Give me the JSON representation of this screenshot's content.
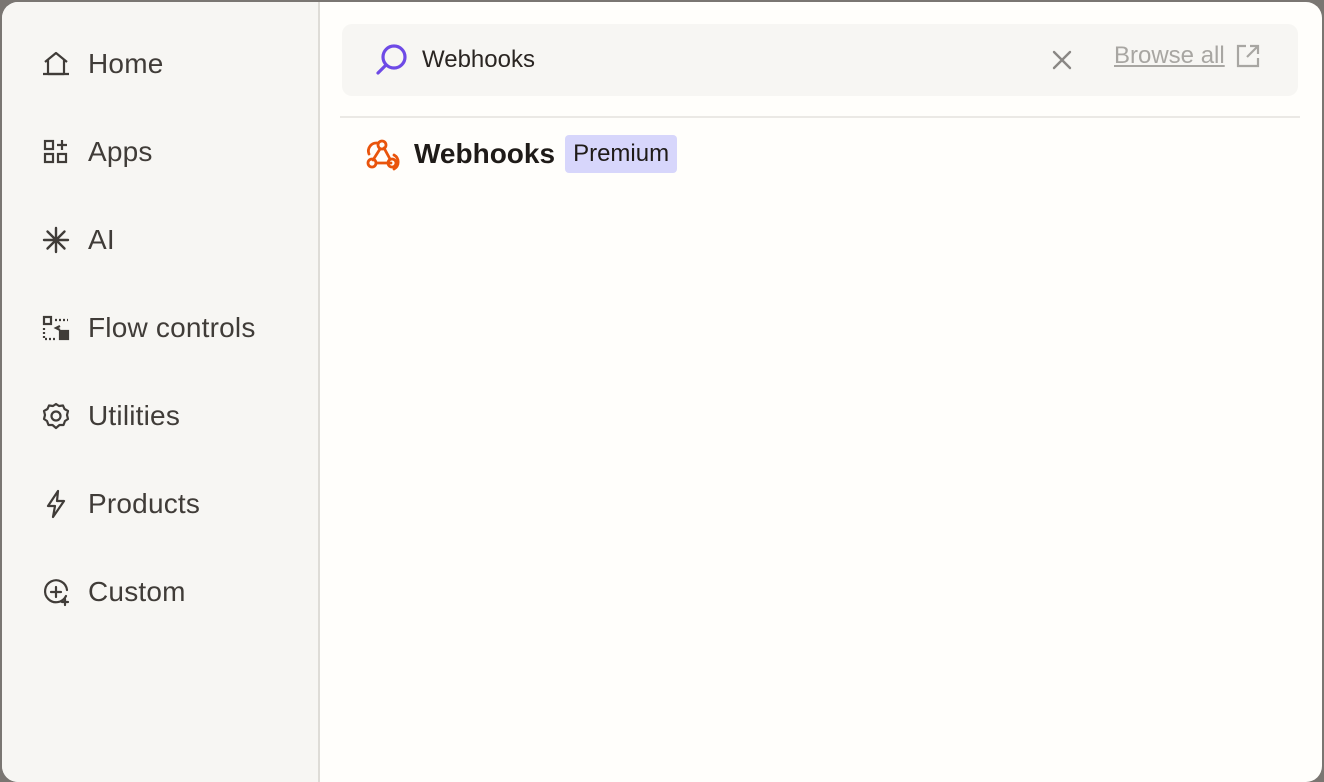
{
  "sidebar": {
    "items": [
      {
        "label": "Home",
        "icon": "home-icon"
      },
      {
        "label": "Apps",
        "icon": "apps-icon"
      },
      {
        "label": "AI",
        "icon": "sparkle-icon"
      },
      {
        "label": "Flow controls",
        "icon": "flow-controls-icon"
      },
      {
        "label": "Utilities",
        "icon": "gear-icon"
      },
      {
        "label": "Products",
        "icon": "lightning-icon"
      },
      {
        "label": "Custom",
        "icon": "custom-plus-icon"
      }
    ]
  },
  "search": {
    "value": "Webhooks",
    "browse_all_label": "Browse all"
  },
  "results": [
    {
      "title": "Webhooks",
      "badge": "Premium",
      "icon": "webhook-icon"
    }
  ],
  "colors": {
    "search_icon": "#6e4ae6",
    "webhook_icon": "#e9540c",
    "badge_bg": "#d7d6fb",
    "sidebar_bg": "#f7f6f3",
    "main_bg": "#fffefb"
  }
}
